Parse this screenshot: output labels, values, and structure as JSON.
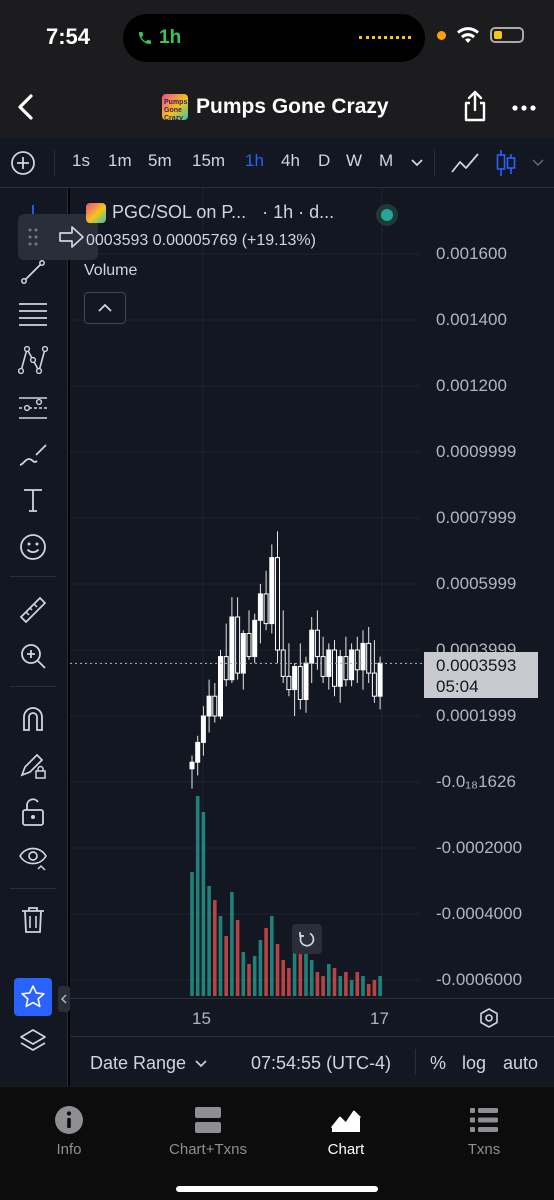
{
  "status_bar": {
    "time": "7:54",
    "call_duration": "1h"
  },
  "nav": {
    "title": "Pumps Gone Crazy",
    "logo_text": "Pumps Gone Crazy"
  },
  "toolbar": {
    "intervals": [
      "1s",
      "1m",
      "5m",
      "15m",
      "1h",
      "4h",
      "D",
      "W",
      "M"
    ],
    "active_interval": "1h"
  },
  "legend": {
    "pair": "PGC/SOL on P...",
    "interval_info": "· 1h · d...",
    "values": "0003593  0.00005769 (+19.13%)"
  },
  "volume_label": "Volume",
  "y_axis": [
    "0.001600",
    "0.001400",
    "0.001200",
    "0.0009999",
    "0.0007999",
    "0.0005999",
    "0.0003999",
    "0.0001999",
    "-0.0₁₈1626",
    "-0.0002000",
    "-0.0004000",
    "-0.0006000"
  ],
  "price_tag": {
    "price": "0.0003593",
    "countdown": "05:04"
  },
  "x_axis": [
    "15",
    "17"
  ],
  "chart_bottom": {
    "date_range": "Date Range",
    "time": "07:54:55 (UTC-4)",
    "percent": "%",
    "log": "log",
    "auto": "auto"
  },
  "tabs": [
    {
      "label": "Info",
      "icon": "info-icon"
    },
    {
      "label": "Chart+Txns",
      "icon": "split-icon"
    },
    {
      "label": "Chart",
      "icon": "chart-icon"
    },
    {
      "label": "Txns",
      "icon": "list-icon"
    }
  ],
  "active_tab": "Chart",
  "colors": {
    "accent": "#2962ff",
    "up": "#26a69a",
    "down": "#ef5350",
    "background": "#131722"
  },
  "chart_data": {
    "type": "candlestick",
    "ylim": [
      -0.00065,
      0.0017
    ],
    "last_price": 0.0003593,
    "candles": [
      [
        4e-05,
        8e-05,
        -2e-05,
        6e-05
      ],
      [
        6e-05,
        0.00014,
        2e-05,
        0.00012
      ],
      [
        0.00012,
        0.00023,
        8e-05,
        0.0002
      ],
      [
        0.0002,
        0.00031,
        0.00015,
        0.00026
      ],
      [
        0.00026,
        0.0003,
        0.00018,
        0.0002
      ],
      [
        0.0002,
        0.0004,
        0.00019,
        0.00038
      ],
      [
        0.00038,
        0.00048,
        0.00029,
        0.00031
      ],
      [
        0.00031,
        0.00056,
        0.0003,
        0.0005
      ],
      [
        0.0005,
        0.00056,
        0.00031,
        0.00033
      ],
      [
        0.00033,
        0.00046,
        0.00028,
        0.00045
      ],
      [
        0.00045,
        0.00052,
        0.00037,
        0.00038
      ],
      [
        0.00038,
        0.00051,
        0.00036,
        0.00049
      ],
      [
        0.00049,
        0.0006,
        0.00042,
        0.00057
      ],
      [
        0.00057,
        0.00064,
        0.00046,
        0.00048
      ],
      [
        0.00048,
        0.00072,
        0.00045,
        0.00068
      ],
      [
        0.00068,
        0.00076,
        0.00036,
        0.0004
      ],
      [
        0.0004,
        0.00052,
        0.0003,
        0.00032
      ],
      [
        0.00032,
        0.00042,
        0.00026,
        0.00028
      ],
      [
        0.00028,
        0.00036,
        0.0002,
        0.00035
      ],
      [
        0.00035,
        0.00042,
        0.00022,
        0.00025
      ],
      [
        0.00025,
        0.00038,
        0.00021,
        0.00036
      ],
      [
        0.00036,
        0.0005,
        0.0003,
        0.00046
      ],
      [
        0.00046,
        0.00052,
        0.00034,
        0.00038
      ],
      [
        0.00038,
        0.00044,
        0.0003,
        0.00032
      ],
      [
        0.00032,
        0.00042,
        0.00028,
        0.0004
      ],
      [
        0.0004,
        0.00043,
        0.00026,
        0.00029
      ],
      [
        0.00029,
        0.0004,
        0.00024,
        0.00038
      ],
      [
        0.00038,
        0.00044,
        0.00029,
        0.00031
      ],
      [
        0.00031,
        0.00042,
        0.00029,
        0.0004
      ],
      [
        0.0004,
        0.00044,
        0.0003,
        0.00034
      ],
      [
        0.00034,
        0.00046,
        0.00028,
        0.00042
      ],
      [
        0.00042,
        0.00047,
        0.0003,
        0.00033
      ],
      [
        0.00033,
        0.00043,
        0.00024,
        0.00026
      ],
      [
        0.00026,
        0.00038,
        0.00022,
        0.00036
      ]
    ],
    "volume_max": 1.0,
    "volumes": [
      0.62,
      1.0,
      0.92,
      0.55,
      0.48,
      0.4,
      0.3,
      0.52,
      0.38,
      0.22,
      0.16,
      0.2,
      0.28,
      0.34,
      0.4,
      0.26,
      0.18,
      0.14,
      0.3,
      0.22,
      0.24,
      0.18,
      0.12,
      0.1,
      0.16,
      0.14,
      0.1,
      0.12,
      0.08,
      0.12,
      0.1,
      0.06,
      0.08,
      0.1
    ]
  }
}
